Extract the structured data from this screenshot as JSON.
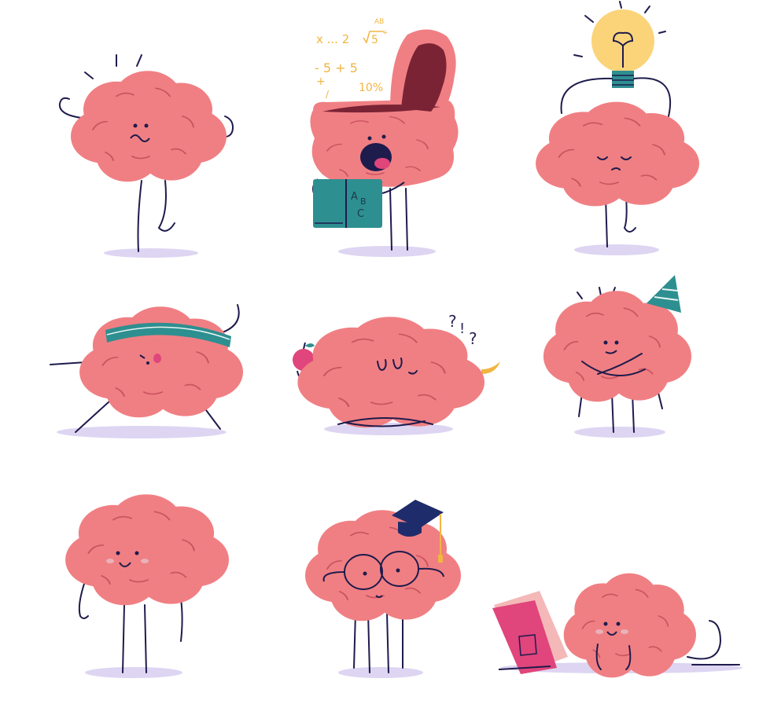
{
  "illustration": {
    "palette": {
      "brain": "#f07f83",
      "brain_fold": "#c9545f",
      "blush": "#e8b3b8",
      "outline": "#1e1b4d",
      "shadow": "#ddd5f2",
      "teal": "#2e8f90",
      "bulb": "#fbd47a",
      "formula": "#f2b542",
      "pink_book": "#e0457b",
      "inner_mouth": "#7a2335",
      "cap": "#1f2c6b"
    },
    "characters": [
      {
        "name": "flexing-brain"
      },
      {
        "name": "open-head-brain"
      },
      {
        "name": "idea-brain"
      },
      {
        "name": "exercising-brain"
      },
      {
        "name": "meditating-brain"
      },
      {
        "name": "party-brain"
      },
      {
        "name": "smiling-brain"
      },
      {
        "name": "graduate-brain"
      },
      {
        "name": "reading-brain"
      }
    ],
    "formula_text": {
      "line1": "x ... 2",
      "root_sup": "AB",
      "root_arg": "5",
      "root_plus": "+",
      "line2": "- 5 + 5",
      "line3": "+",
      "line4": "10%",
      "line5": "/"
    },
    "book_letters": {
      "a": "A",
      "b": "B",
      "c": "C"
    },
    "question_marks": {
      "q1": "?",
      "q2": "!",
      "q3": "?"
    }
  }
}
